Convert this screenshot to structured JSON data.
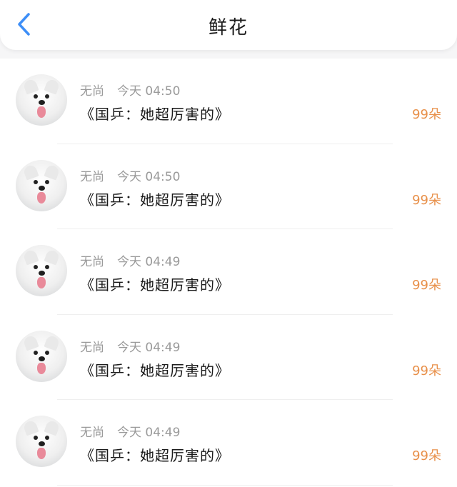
{
  "header": {
    "title": "鲜花",
    "back_icon": "chevron-left-icon",
    "accent_color": "#3d8ef7"
  },
  "gift_list": {
    "count_color": "#e8904a",
    "items": [
      {
        "user": "无尚",
        "time": "今天 04:50",
        "message": "《国乒：她超厉害的》",
        "count": "99朵"
      },
      {
        "user": "无尚",
        "time": "今天 04:50",
        "message": "《国乒：她超厉害的》",
        "count": "99朵"
      },
      {
        "user": "无尚",
        "time": "今天 04:49",
        "message": "《国乒：她超厉害的》",
        "count": "99朵"
      },
      {
        "user": "无尚",
        "time": "今天 04:49",
        "message": "《国乒：她超厉害的》",
        "count": "99朵"
      },
      {
        "user": "无尚",
        "time": "今天 04:49",
        "message": "《国乒：她超厉害的》",
        "count": "99朵"
      }
    ]
  }
}
